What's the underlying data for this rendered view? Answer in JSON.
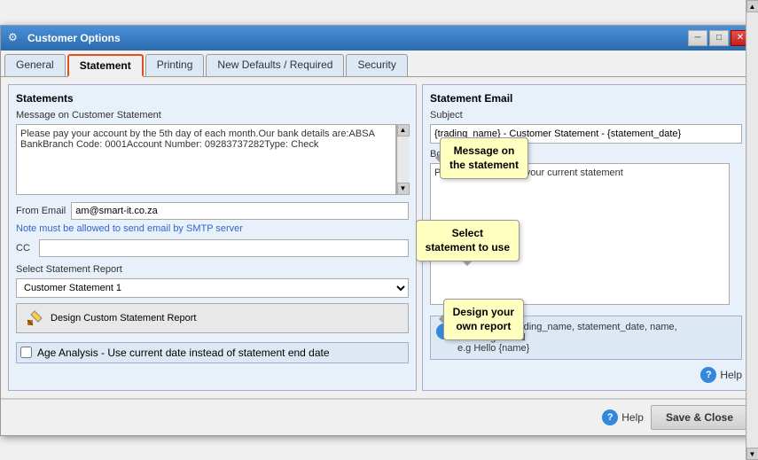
{
  "window": {
    "title": "Customer Options",
    "icon": "⚙"
  },
  "titleButtons": {
    "minimize": "─",
    "maximize": "□",
    "close": "✕"
  },
  "tabs": [
    {
      "id": "general",
      "label": "General",
      "active": false
    },
    {
      "id": "statement",
      "label": "Statement",
      "active": true
    },
    {
      "id": "printing",
      "label": "Printing",
      "active": false
    },
    {
      "id": "new-defaults",
      "label": "New Defaults / Required",
      "active": false
    },
    {
      "id": "security",
      "label": "Security",
      "active": false
    }
  ],
  "leftPanel": {
    "title": "Statements",
    "messageSection": {
      "label": "Message on Customer Statement",
      "value": "Please pay your account by the 5th day of each month.Our bank details are:ABSA BankBranch Code: 0001Account Number: 09283737282Type: Check"
    },
    "fromEmail": {
      "label": "From Email",
      "value": "am@smart-it.co.za"
    },
    "note": "Note must be allowed to send email by SMTP server",
    "cc": {
      "label": "CC",
      "value": ""
    },
    "selectStatement": {
      "label": "Select Statement Report",
      "value": "Customer Statement 1"
    },
    "designButton": {
      "label": "Design Custom Statement Report",
      "icon": "🔧"
    },
    "ageAnalysis": {
      "label": "Age Analysis - Use current date instead of statement end date"
    }
  },
  "rightPanel": {
    "title": "Statement Email",
    "subject": {
      "label": "Subject",
      "value": "{trading_name} - Customer Statement - {statement_date}"
    },
    "body": {
      "label": "Body",
      "value": "Please see attached your current statement"
    },
    "shortcodes": {
      "info": "Shortcodes: trading_name, statement_date, name, nameregistered\ne.g Hello {name}"
    }
  },
  "callouts": {
    "message": {
      "line1": "Message on",
      "line2": "the statement"
    },
    "select": {
      "line1": "Select",
      "line2": "statement to use"
    },
    "design": {
      "line1": "Design your",
      "line2": "own report"
    }
  },
  "bottomBar": {
    "helpLabel": "Help",
    "saveCloseLabel": "Save & Close"
  }
}
